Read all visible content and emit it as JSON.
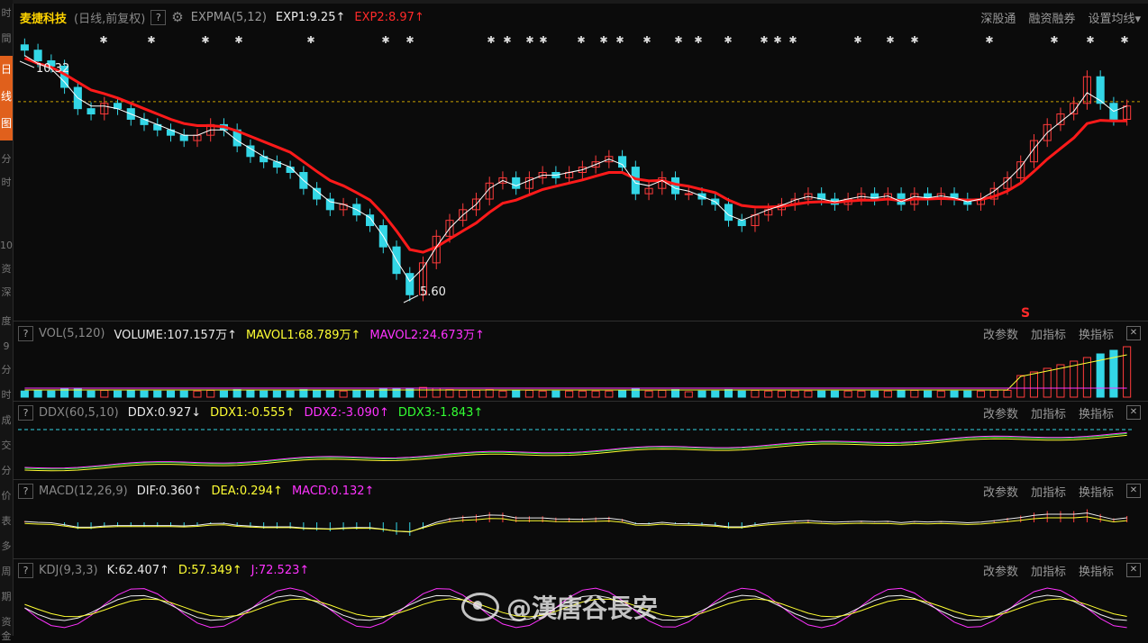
{
  "left_sidebar": {
    "items": [
      "时",
      "間",
      "分",
      "时",
      "10",
      "资",
      "深",
      "度",
      "9",
      "分",
      "时",
      "成",
      "交",
      "分",
      "价",
      "表",
      "多",
      "周",
      "期",
      "资",
      "金"
    ],
    "active_label": "日线图"
  },
  "main_header": {
    "stock_name": "麦捷科技",
    "period_label": "(日线,前复权)",
    "help": "?",
    "gear": "gear-icon",
    "indicator": "EXPMA(5,12)",
    "exp1": "EXP1:9.25",
    "exp1_arrow": "↑",
    "exp2": "EXP2:8.97",
    "exp2_arrow": "↑",
    "links": [
      "深股通",
      "融资融券",
      "设置均线"
    ],
    "setting_arrow": "▾"
  },
  "price_annotations": {
    "high": "10.32",
    "low": "5.60",
    "signal": "S"
  },
  "panels": [
    {
      "name": "VOL(5,120)",
      "values": [
        {
          "text": "VOLUME:107.157万",
          "arrow": "↑",
          "color": "#e8e8e8"
        },
        {
          "text": "MAVOL1:68.789万",
          "arrow": "↑",
          "color": "#ffff33"
        },
        {
          "text": "MAVOL2:24.673万",
          "arrow": "↑",
          "color": "#ff33ff"
        }
      ]
    },
    {
      "name": "DDX(60,5,10)",
      "values": [
        {
          "text": "DDX:0.927",
          "arrow": "↓",
          "color": "#e8e8e8"
        },
        {
          "text": "DDX1:-0.555",
          "arrow": "↑",
          "color": "#ffff33"
        },
        {
          "text": "DDX2:-3.090",
          "arrow": "↑",
          "color": "#ff33ff"
        },
        {
          "text": "DDX3:-1.843",
          "arrow": "↑",
          "color": "#33ff33"
        }
      ]
    },
    {
      "name": "MACD(12,26,9)",
      "values": [
        {
          "text": "DIF:0.360",
          "arrow": "↑",
          "color": "#e8e8e8"
        },
        {
          "text": "DEA:0.294",
          "arrow": "↑",
          "color": "#ffff33"
        },
        {
          "text": "MACD:0.132",
          "arrow": "↑",
          "color": "#ff33ff"
        }
      ]
    },
    {
      "name": "KDJ(9,3,3)",
      "values": [
        {
          "text": "K:62.407",
          "arrow": "↑",
          "color": "#e8e8e8"
        },
        {
          "text": "D:57.349",
          "arrow": "↑",
          "color": "#ffff33"
        },
        {
          "text": "J:72.523",
          "arrow": "↑",
          "color": "#ff33ff"
        }
      ]
    }
  ],
  "panel_actions": [
    "改参数",
    "加指标",
    "换指标"
  ],
  "close_glyph": "✕",
  "watermark": "@漢唐谷長安",
  "colors": {
    "up": "#ff3b3b",
    "down": "#33d6e6",
    "exp1": "#ffffff",
    "exp2": "#ff1a1a",
    "vol_ma1": "#ffff33",
    "vol_ma2": "#ff33ff"
  },
  "chart_data": {
    "type": "candlestick",
    "title": "麦捷科技",
    "indicator": "EXPMA(5,12)",
    "price_high": 10.32,
    "price_low": 5.6,
    "closes": [
      10.3,
      10.1,
      10.0,
      9.6,
      9.2,
      9.1,
      9.3,
      9.2,
      9.0,
      8.9,
      8.8,
      8.7,
      8.6,
      8.7,
      8.9,
      8.8,
      8.5,
      8.3,
      8.2,
      8.1,
      8.0,
      7.7,
      7.5,
      7.3,
      7.4,
      7.2,
      7.0,
      6.6,
      6.1,
      5.7,
      6.3,
      6.8,
      7.1,
      7.3,
      7.5,
      7.8,
      7.9,
      7.7,
      7.9,
      8.0,
      7.9,
      8.0,
      8.1,
      8.2,
      8.3,
      8.1,
      7.6,
      7.7,
      7.9,
      7.6,
      7.6,
      7.5,
      7.4,
      7.1,
      7.0,
      7.2,
      7.3,
      7.4,
      7.5,
      7.6,
      7.5,
      7.4,
      7.5,
      7.6,
      7.5,
      7.6,
      7.4,
      7.6,
      7.5,
      7.6,
      7.5,
      7.4,
      7.5,
      7.7,
      7.9,
      8.2,
      8.6,
      8.9,
      9.1,
      9.3,
      9.8,
      9.3,
      9.0,
      9.25
    ],
    "exp1": [
      10.2,
      10.05,
      9.95,
      9.7,
      9.4,
      9.25,
      9.25,
      9.2,
      9.1,
      9.0,
      8.9,
      8.8,
      8.7,
      8.7,
      8.8,
      8.8,
      8.6,
      8.45,
      8.3,
      8.2,
      8.1,
      7.85,
      7.65,
      7.45,
      7.4,
      7.3,
      7.15,
      6.8,
      6.35,
      5.95,
      6.2,
      6.6,
      6.95,
      7.2,
      7.4,
      7.7,
      7.85,
      7.75,
      7.85,
      7.95,
      7.95,
      8.0,
      8.05,
      8.15,
      8.25,
      8.15,
      7.8,
      7.75,
      7.85,
      7.7,
      7.65,
      7.55,
      7.45,
      7.2,
      7.1,
      7.2,
      7.3,
      7.38,
      7.48,
      7.55,
      7.5,
      7.45,
      7.5,
      7.55,
      7.52,
      7.56,
      7.45,
      7.55,
      7.52,
      7.56,
      7.52,
      7.45,
      7.5,
      7.65,
      7.85,
      8.1,
      8.45,
      8.75,
      8.95,
      9.15,
      9.5,
      9.35,
      9.15,
      9.25
    ],
    "exp2": [
      10.15,
      10.05,
      9.98,
      9.85,
      9.7,
      9.55,
      9.48,
      9.4,
      9.3,
      9.2,
      9.1,
      9.0,
      8.92,
      8.88,
      8.88,
      8.86,
      8.78,
      8.68,
      8.58,
      8.48,
      8.38,
      8.2,
      8.02,
      7.85,
      7.75,
      7.62,
      7.48,
      7.22,
      6.9,
      6.55,
      6.5,
      6.6,
      6.75,
      6.9,
      7.05,
      7.25,
      7.42,
      7.48,
      7.58,
      7.68,
      7.74,
      7.8,
      7.86,
      7.93,
      8.0,
      8.0,
      7.88,
      7.84,
      7.85,
      7.78,
      7.74,
      7.68,
      7.62,
      7.48,
      7.38,
      7.35,
      7.35,
      7.36,
      7.4,
      7.44,
      7.45,
      7.44,
      7.46,
      7.48,
      7.48,
      7.5,
      7.47,
      7.5,
      7.5,
      7.51,
      7.5,
      7.48,
      7.49,
      7.55,
      7.65,
      7.8,
      8.02,
      8.25,
      8.45,
      8.65,
      8.92,
      8.98,
      8.97,
      8.97
    ],
    "ylim": [
      5.4,
      10.6
    ]
  }
}
